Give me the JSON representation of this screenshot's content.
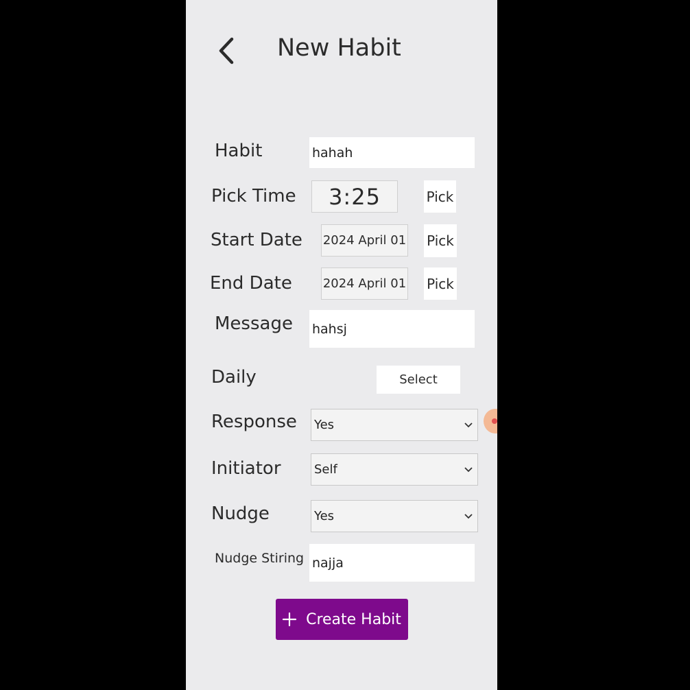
{
  "header": {
    "title": "New Habit",
    "back_icon": "chevron-left-icon"
  },
  "form": {
    "habit_label": "Habit",
    "habit_value": "hahah",
    "pick_time_label": "Pick Time",
    "time_value": "3:25",
    "pick_label": "Pick",
    "start_date_label": "Start Date",
    "start_date_value": "2024 April 01",
    "end_date_label": "End Date",
    "end_date_value": "2024 April 01",
    "message_label": "Message",
    "message_value": "hahsj",
    "daily_label": "Daily",
    "select_label": "Select",
    "response_label": "Response",
    "response_value": "Yes",
    "initiator_label": "Initiator",
    "initiator_value": "Self",
    "nudge_label": "Nudge",
    "nudge_value": "Yes",
    "nudge_string_label": "Nudge Stiring",
    "nudge_string_value": "najja"
  },
  "actions": {
    "create_label": "Create Habit",
    "create_icon": "plus-icon"
  },
  "colors": {
    "accent": "#7e0a8c",
    "background": "#ebebed"
  }
}
